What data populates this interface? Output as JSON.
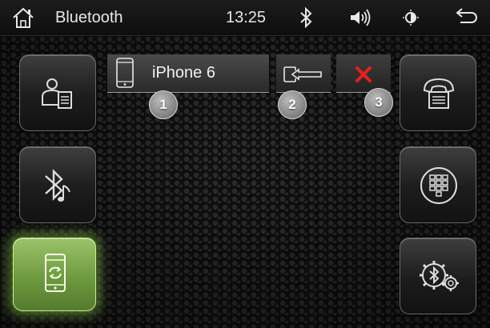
{
  "statusbar": {
    "title": "Bluetooth",
    "time": "13:25",
    "icons": [
      "home-icon",
      "bluetooth-icon",
      "volume-icon",
      "brightness-icon",
      "back-icon"
    ]
  },
  "left_buttons": [
    "contacts-icon",
    "bluetooth-music-icon",
    "phone-sync-icon"
  ],
  "right_buttons": [
    "call-log-icon",
    "keypad-icon",
    "bluetooth-settings-icon"
  ],
  "active_button": "phone-sync",
  "device": {
    "name": "iPhone 6",
    "icons": [
      "phone-icon",
      "connect-icon",
      "delete-icon"
    ]
  },
  "callouts": [
    "1",
    "2",
    "3"
  ],
  "colors": {
    "active_green": "#7fae4a",
    "delete_red": "#e8201c",
    "text": "#f2f2f2"
  }
}
